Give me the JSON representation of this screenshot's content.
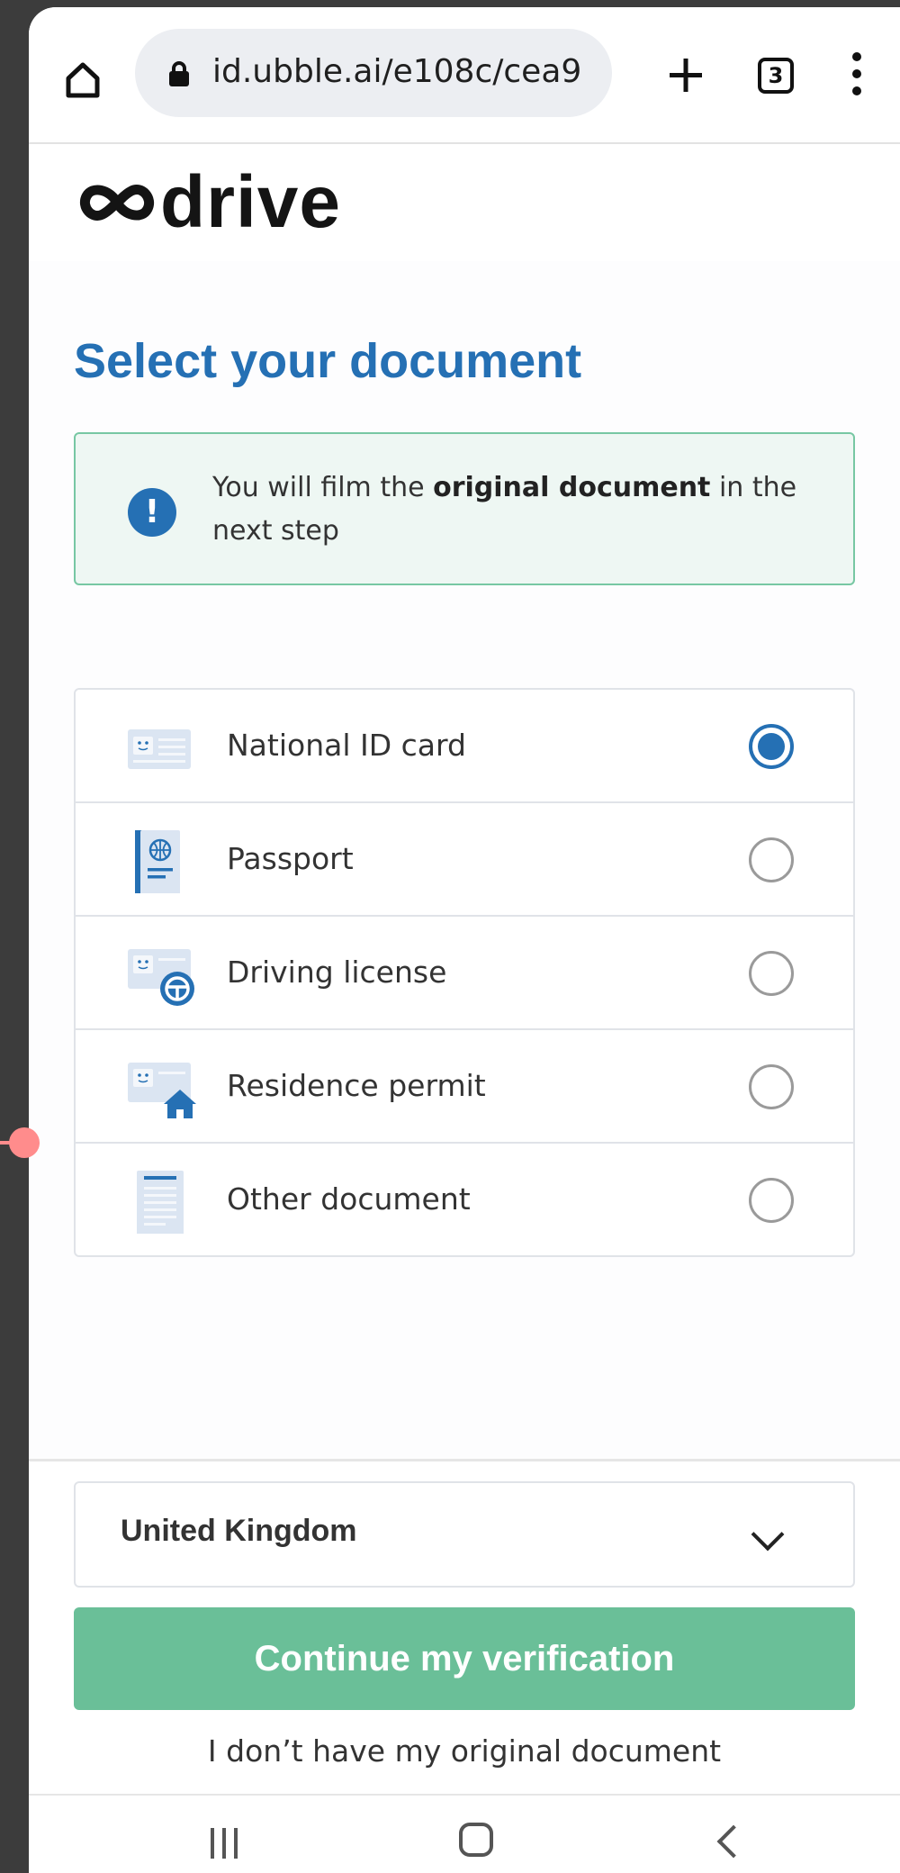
{
  "browser": {
    "url": "id.ubble.ai/e108c/cea9",
    "tab_count": "3"
  },
  "header": {
    "logo_text": "drive"
  },
  "page": {
    "title": "Select your document",
    "info": {
      "prefix": "You will film the ",
      "bold": "original document",
      "suffix": " in the next step"
    },
    "documents": [
      {
        "label": "National ID card",
        "icon": "id-card-icon",
        "selected": true
      },
      {
        "label": "Passport",
        "icon": "passport-icon",
        "selected": false
      },
      {
        "label": "Driving license",
        "icon": "driving-license-icon",
        "selected": false
      },
      {
        "label": "Residence permit",
        "icon": "residence-permit-icon",
        "selected": false
      },
      {
        "label": "Other document",
        "icon": "document-icon",
        "selected": false
      }
    ]
  },
  "footer": {
    "country": "United Kingdom",
    "continue_label": "Continue my verification",
    "no_document_label": "I don’t have my original document"
  },
  "colors": {
    "primary": "#2570b4",
    "success": "#6abf98",
    "info_bg": "#eef7f3"
  }
}
